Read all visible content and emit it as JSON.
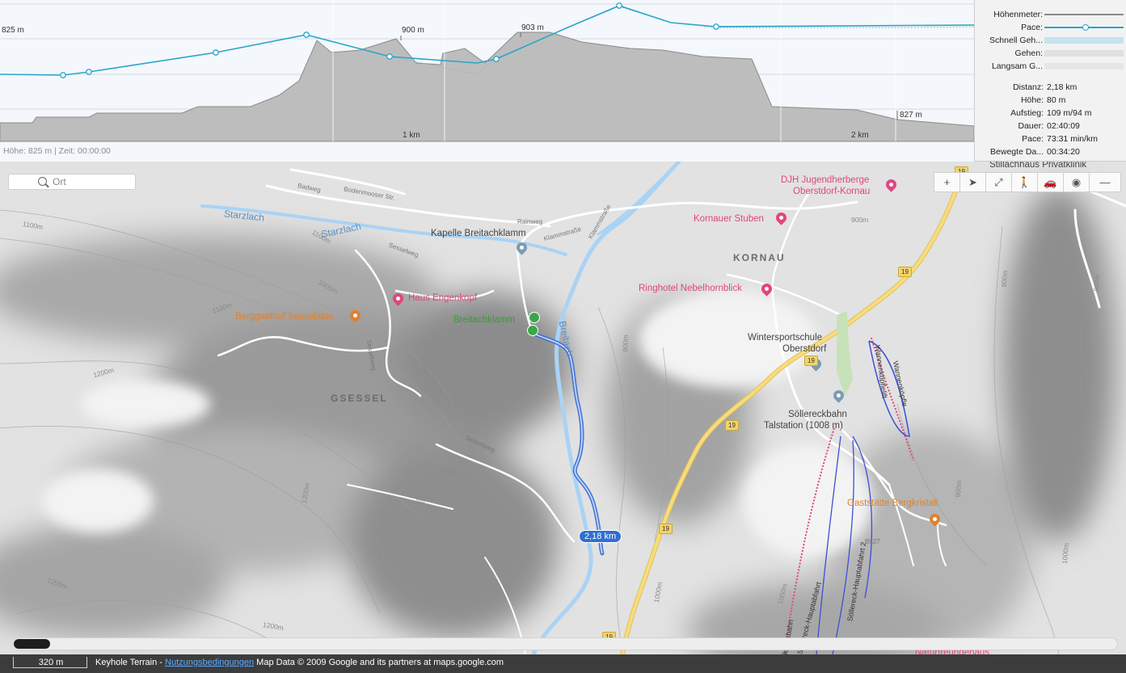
{
  "profile": {
    "elevation_labels": [
      "825 m",
      "900 m",
      "903 m",
      "827 m"
    ],
    "distance_labels": [
      "1 km",
      "2 km"
    ],
    "status": "Höhe: 825 m | Zeit: 00:00:00",
    "colors": {
      "elevation_fill": "#bdbdbd",
      "pace_line": "#2aa6c9",
      "background": "#f4f7fb"
    }
  },
  "legend": {
    "rows": [
      {
        "label": "Höhenmeter:",
        "swatch": "line-gray"
      },
      {
        "label": "Pace:",
        "swatch": "line-blue-dot"
      },
      {
        "label": "Schnell Geh...",
        "swatch": "bar-lightblue"
      },
      {
        "label": "Gehen:",
        "swatch": "bar-lightgray"
      },
      {
        "label": "Langsam G...",
        "swatch": "bar-lightgray"
      }
    ],
    "stats": [
      {
        "label": "Distanz:",
        "value": "2,18 km"
      },
      {
        "label": "Höhe:",
        "value": "80 m"
      },
      {
        "label": "Aufstieg:",
        "value": "109 m/94 m"
      },
      {
        "label": "Dauer:",
        "value": "02:40:09"
      },
      {
        "label": "Pace:",
        "value": "73:31 min/km"
      },
      {
        "label": "Bewegte Da...",
        "value": "00:34:20"
      }
    ]
  },
  "search": {
    "placeholder": "Ort",
    "icon": "magnifier-icon"
  },
  "toolbar": [
    {
      "name": "zoom-in-button",
      "glyph": "+"
    },
    {
      "name": "locate-button",
      "glyph": "➤"
    },
    {
      "name": "fullscreen-button",
      "glyph": "⤢"
    },
    {
      "name": "walk-mode-button",
      "glyph": "🚶"
    },
    {
      "name": "car-mode-button",
      "glyph": "🚗"
    },
    {
      "name": "globe-button",
      "glyph": "◉"
    },
    {
      "name": "collapse-button",
      "glyph": "—"
    }
  ],
  "map": {
    "places": {
      "stillachhaus": "Stillachhaus Privatklinik",
      "djh_line1": "DJH Jugendherberge",
      "djh_line2": "Oberstdorf-Kornau",
      "kornauer_stuben": "Kornauer Stuben",
      "kornau": "KORNAU",
      "ringhotel": "Ringhotel Nebelhornblick",
      "wintersport_line1": "Wintersportschule",
      "wintersport_line2": "Oberstdorf",
      "soellereck_line1": "Söllereckbahn",
      "soellereck_line2": "Talstation (1008 m)",
      "gaststaette": "Gaststätte Bergkristall",
      "naturfreundehaus": "Naturfreundehaus",
      "kapelle": "Kapelle Breitachklamm",
      "haus_engenkopf": "Haus Engenkopf",
      "berggasthof": "Berggasthof Sesselalpe",
      "breitachklamm": "Breitachklamm",
      "gsessel": "GSESSEL"
    },
    "water": {
      "starzlach1": "Starzlach",
      "starzlach2": "Starzlach",
      "breitach": "Breitach"
    },
    "roads": {
      "badweg": "Badweg",
      "bodenmooser": "Bodenmooser Str.",
      "rainweg": "Rainweg",
      "klammstrasse1": "Klammstraße",
      "klammstrasse2": "Klammstraße",
      "sesselweg1": "Sesselweg",
      "sesselweg2": "Sesselweg",
      "sesselweg3": "Sesselweg",
      "wannenkopfe": "Wannenköpfle",
      "wannenkopflelift": "Wannenköpflelift",
      "hauptabfahrt1": "Söllereck-Hauptabfahrt",
      "hauptabfahrt2": "Söllereck-Hauptabfahrt 2",
      "bahn": "Söllereckbahn",
      "b19": "19",
      "b527": "B527"
    },
    "contours": [
      "1100m",
      "1100m",
      "1000m",
      "1100m",
      "1200m",
      "1000m",
      "1100m",
      "1200m",
      "1200m",
      "1200m",
      "900m",
      "900m",
      "900m",
      "1000m",
      "1000m",
      "900m",
      "1000m",
      "900m"
    ],
    "route_distance": "2,18 km",
    "colors": {
      "route": "#3d6fd6",
      "highway": "#f3d36b",
      "river": "#a9d3f5",
      "poi": "#e0457f"
    }
  },
  "bottom": {
    "scale": "320 m",
    "attribution_prefix": "Keyhole Terrain - ",
    "terms_link": "Nutzungsbedingungen",
    "attribution_suffix": " Map Data © 2009 Google and its partners at maps.google.com"
  }
}
